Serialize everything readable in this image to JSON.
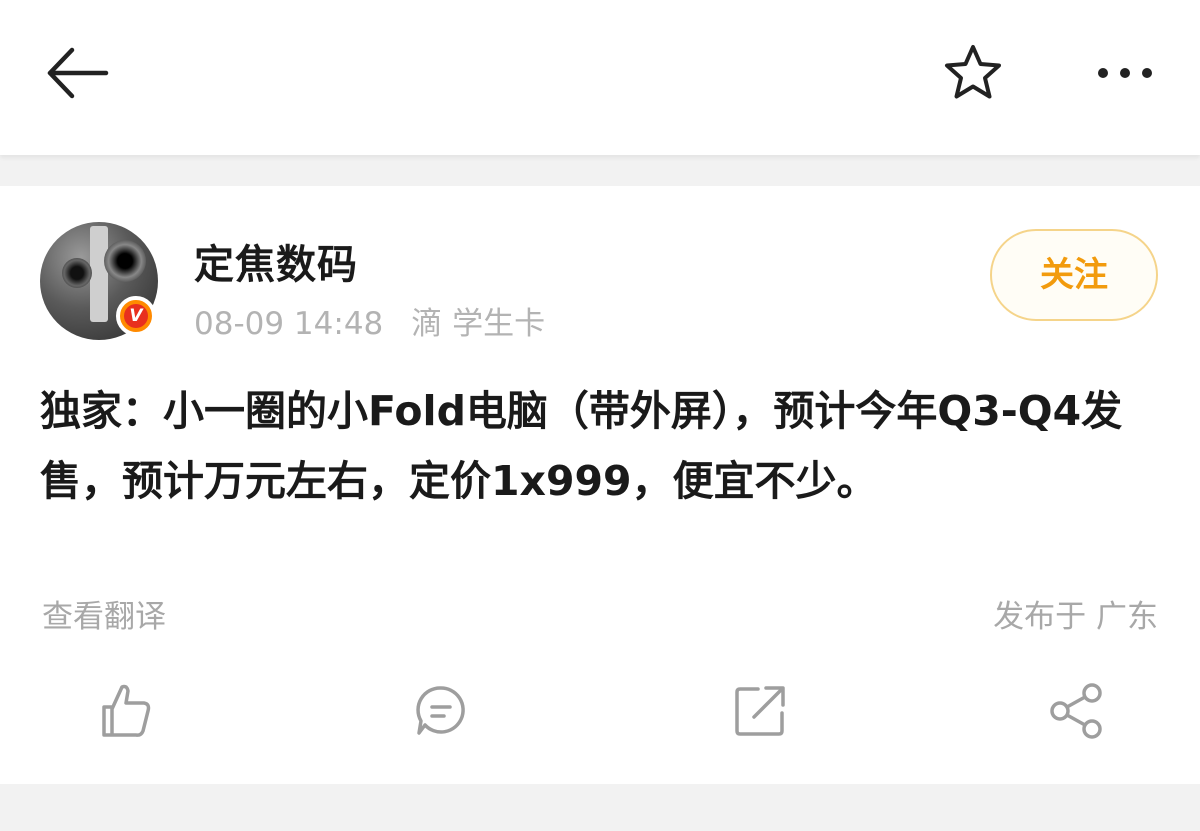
{
  "user": {
    "name": "定焦数码",
    "timestamp": "08-09 14:48",
    "device": "滴 学生卡",
    "verified_badge": "V"
  },
  "follow_button": {
    "label": "关注"
  },
  "post": {
    "text": "独家：小一圈的小Fold电脑（带外屏），预计今年Q3-Q4发售，预计万元左右，定价1x999，便宜不少。",
    "translate_label": "查看翻译",
    "location_label": "发布于 广东"
  },
  "icons": {
    "back": "back-arrow-icon",
    "favorite": "star-icon",
    "more": "more-dots-icon",
    "like": "thumbs-up-icon",
    "comment": "comment-icon",
    "repost": "repost-icon",
    "share": "share-icon"
  },
  "colors": {
    "accent": "#f29b0d",
    "follow_border": "#f5d48a",
    "muted_text": "#a8a8a8",
    "badge_red": "#e8301e",
    "badge_orange": "#ff8a00"
  }
}
